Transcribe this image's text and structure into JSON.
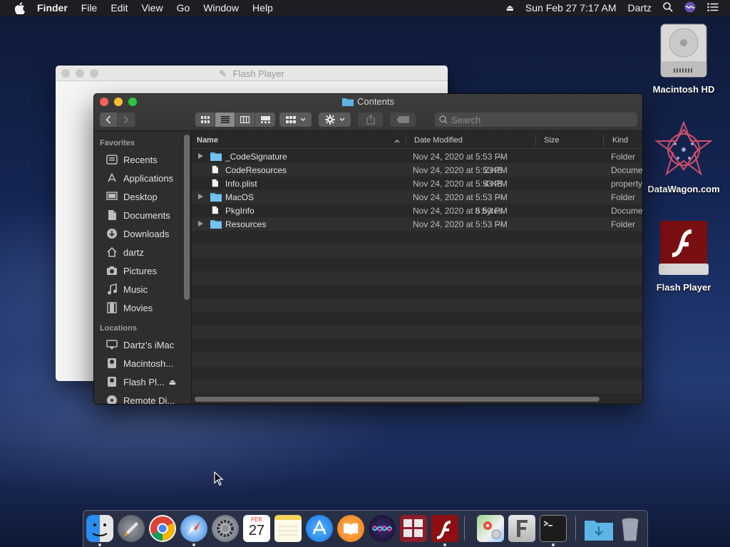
{
  "menubar": {
    "items": [
      "Finder",
      "File",
      "Edit",
      "View",
      "Go",
      "Window",
      "Help"
    ],
    "clock": "Sun Feb 27  7:17 AM",
    "user": "Dartz"
  },
  "desktop": {
    "icons": [
      {
        "label": "Macintosh HD"
      },
      {
        "label": "DataWagon.com"
      },
      {
        "label": "Flash Player"
      }
    ]
  },
  "back_window": {
    "title": "Flash Player"
  },
  "finder": {
    "title": "Contents",
    "search_placeholder": "Search",
    "sidebar": {
      "favorites_header": "Favorites",
      "favorites": [
        {
          "label": "Recents",
          "icon": "recents-icon"
        },
        {
          "label": "Applications",
          "icon": "applications-icon"
        },
        {
          "label": "Desktop",
          "icon": "desktop-icon"
        },
        {
          "label": "Documents",
          "icon": "documents-icon"
        },
        {
          "label": "Downloads",
          "icon": "downloads-icon"
        },
        {
          "label": "dartz",
          "icon": "home-icon"
        },
        {
          "label": "Pictures",
          "icon": "pictures-icon"
        },
        {
          "label": "Music",
          "icon": "music-icon"
        },
        {
          "label": "Movies",
          "icon": "movies-icon"
        }
      ],
      "locations_header": "Locations",
      "locations": [
        {
          "label": "Dartz’s iMac",
          "icon": "imac-icon"
        },
        {
          "label": "Macintosh...",
          "icon": "disk-icon"
        },
        {
          "label": "Flash Pl...",
          "icon": "disk-icon"
        },
        {
          "label": "Remote Di...",
          "icon": "remote-disc-icon"
        }
      ]
    },
    "columns": {
      "name": "Name",
      "date": "Date Modified",
      "size": "Size",
      "kind": "Kind"
    },
    "rows": [
      {
        "name": "_CodeSignature",
        "date": "Nov 24, 2020 at 5:53 PM",
        "size": "--",
        "kind": "Folder",
        "type": "folder"
      },
      {
        "name": "CodeResources",
        "date": "Nov 24, 2020 at 5:53 PM",
        "size": "2 KB",
        "kind": "Docume",
        "type": "file"
      },
      {
        "name": "Info.plist",
        "date": "Nov 24, 2020 at 5:53 PM",
        "size": "4 KB",
        "kind": "property",
        "type": "file"
      },
      {
        "name": "MacOS",
        "date": "Nov 24, 2020 at 5:53 PM",
        "size": "--",
        "kind": "Folder",
        "type": "folder"
      },
      {
        "name": "PkgInfo",
        "date": "Nov 24, 2020 at 5:53 PM",
        "size": "8 bytes",
        "kind": "Docume",
        "type": "file"
      },
      {
        "name": "Resources",
        "date": "Nov 24, 2020 at 5:53 PM",
        "size": "--",
        "kind": "Folder",
        "type": "folder"
      }
    ]
  },
  "dock": {
    "calendar_month": "FEB",
    "calendar_day": "27",
    "apps": [
      "finder-icon",
      "launchpad-icon",
      "chrome-icon",
      "safari-icon",
      "system-preferences-icon",
      "calendar-icon",
      "notes-icon",
      "app-store-icon",
      "books-icon",
      "siri-icon",
      "photo-booth-icon",
      "flash-player-icon",
      "maps-icon",
      "font-book-icon",
      "terminal-icon",
      "downloads-folder-icon",
      "trash-icon"
    ]
  }
}
